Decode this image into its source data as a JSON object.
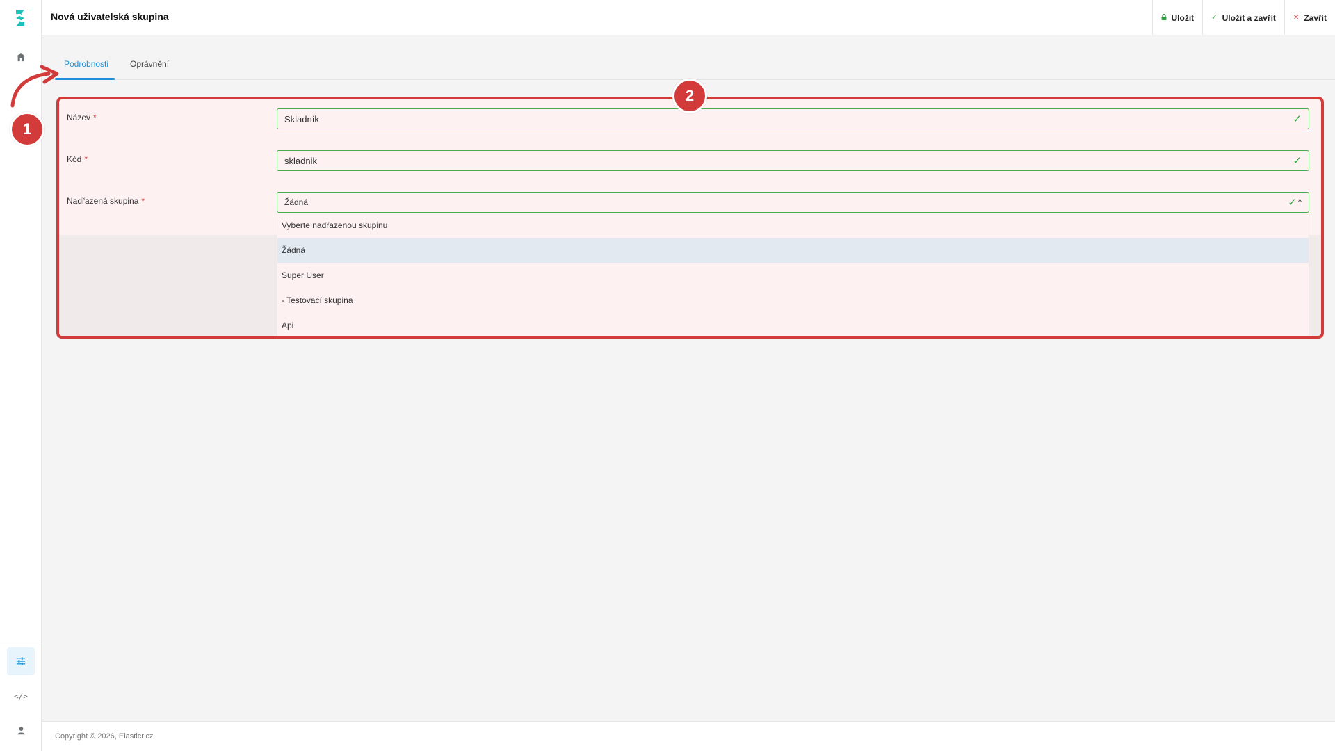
{
  "app": {
    "title": "Nová uživatelská skupina"
  },
  "header": {
    "actions": [
      {
        "label": "Uložit",
        "icon": "lock-icon"
      },
      {
        "label": "Uložit a zavřít",
        "icon": "check-icon"
      },
      {
        "label": "Zavřít",
        "icon": "close-icon"
      }
    ]
  },
  "tabs": [
    {
      "label": "Podrobnosti",
      "active": true
    },
    {
      "label": "Oprávnění",
      "active": false
    }
  ],
  "form": {
    "name": {
      "label": "Název",
      "required": "*",
      "value": "Skladník"
    },
    "code": {
      "label": "Kód",
      "required": "*",
      "value": "skladnik"
    },
    "parent": {
      "label": "Nadřazená skupina",
      "required": "*",
      "value": "Žádná",
      "options": [
        "Vyberte nadřazenou skupinu",
        "Žádná",
        "Super User",
        "- Testovací skupina",
        "Api"
      ],
      "selected_option": "Žádná"
    }
  },
  "annotations": {
    "step1": "1",
    "step2": "2"
  },
  "footer": {
    "copyright": "Copyright © 2026, Elasticr.cz"
  },
  "colors": {
    "accent": "#1e90d6",
    "valid": "#2e9d3d",
    "annotation": "#d33b3b",
    "brand_logo": "#18c2b8"
  },
  "sidebar": {
    "icons": [
      "home-icon",
      "settings-sliders-icon",
      "code-icon",
      "user-icon"
    ]
  }
}
